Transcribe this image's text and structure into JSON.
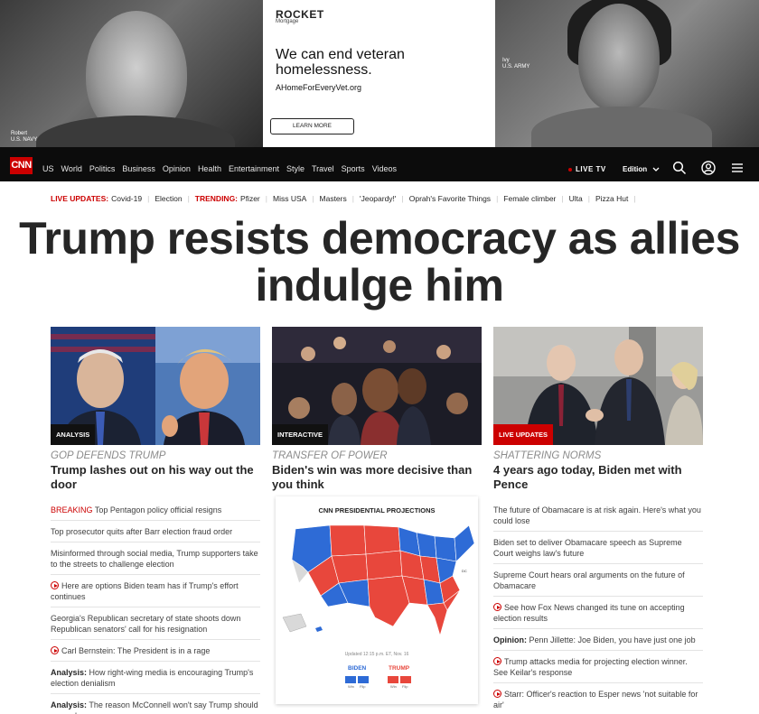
{
  "ad": {
    "brand": "ROCKET",
    "brand_sub": "Mortgage",
    "headline": "We can end veteran homelessness.",
    "url": "AHomeForEveryVet.org",
    "cta": "LEARN MORE",
    "left_caption_name": "Robert",
    "left_caption_branch": "U.S. NAVY",
    "right_caption_name": "Ivy",
    "right_caption_branch": "U.S. ARMY"
  },
  "nav": {
    "logo": "CNN",
    "links": [
      "US",
      "World",
      "Politics",
      "Business",
      "Opinion",
      "Health",
      "Entertainment",
      "Style",
      "Travel",
      "Sports",
      "Videos"
    ],
    "live_tv": "LIVE TV",
    "edition": "Edition"
  },
  "trending": {
    "live_label": "LIVE UPDATES:",
    "live_items": [
      "Covid-19",
      "Election"
    ],
    "trending_label": "TRENDING:",
    "trending_items": [
      "Pfizer",
      "Miss USA",
      "Masters",
      "'Jeopardy!'",
      "Oprah's Favorite Things",
      "Female climber",
      "Ulta",
      "Pizza Hut"
    ]
  },
  "headline": "Trump resists democracy as allies indulge him",
  "columns": [
    {
      "badge": "ANALYSIS",
      "kicker": "GOP DEFENDS TRUMP",
      "title": "Trump lashes out on his way out the door",
      "items": [
        {
          "prefix": "BREAKING",
          "text": "Top Pentagon policy official resigns"
        },
        {
          "text": "Top prosecutor quits after Barr election fraud order"
        },
        {
          "text": "Misinformed through social media, Trump supporters take to the streets to challenge election"
        },
        {
          "video": true,
          "text": "Here are options Biden team has if Trump's effort continues"
        },
        {
          "text": "Georgia's Republican secretary of state shoots down Republican senators' call for his resignation"
        },
        {
          "video": true,
          "text": "Carl Bernstein: The President is in a rage"
        },
        {
          "bold": "Analysis:",
          "text": "How right-wing media is encouraging Trump's election denialism"
        },
        {
          "bold": "Analysis:",
          "text": "The reason McConnell won't say Trump should concede"
        }
      ]
    },
    {
      "badge": "INTERACTIVE",
      "kicker": "TRANSFER OF POWER",
      "title": "Biden's win was more decisive than you think",
      "map": {
        "title": "CNN PRESIDENTIAL PROJECTIONS",
        "updated": "Updated 12:15 p.m. ET, Nov. 16",
        "biden": "BIDEN",
        "trump": "TRUMP",
        "win": "Win",
        "flip": "Flip"
      }
    },
    {
      "badge": "LIVE UPDATES",
      "kicker": "SHATTERING NORMS",
      "title": "4 years ago today, Biden met with Pence",
      "items": [
        {
          "text": "The future of Obamacare is at risk again. Here's what you could lose"
        },
        {
          "text": "Biden set to deliver Obamacare speech as Supreme Court weighs law's future"
        },
        {
          "text": "Supreme Court hears oral arguments on the future of Obamacare"
        },
        {
          "video": true,
          "text": "See how Fox News changed its tune on accepting election results"
        },
        {
          "bold": "Opinion:",
          "text": "Penn Jillette: Joe Biden, you have just one job"
        },
        {
          "video": true,
          "text": "Trump attacks media for projecting election winner. See Keilar's response"
        },
        {
          "video": true,
          "text": "Starr: Officer's reaction to Esper news 'not suitable for air'"
        }
      ]
    }
  ],
  "colors": {
    "cnn_red": "#cc0000",
    "nav_bg": "#0c0c0c",
    "biden_blue": "#2e6bd6",
    "trump_red": "#e8473c"
  },
  "icons": [
    "search-icon",
    "user-icon",
    "menu-icon",
    "chevron-down-icon",
    "play-icon"
  ]
}
